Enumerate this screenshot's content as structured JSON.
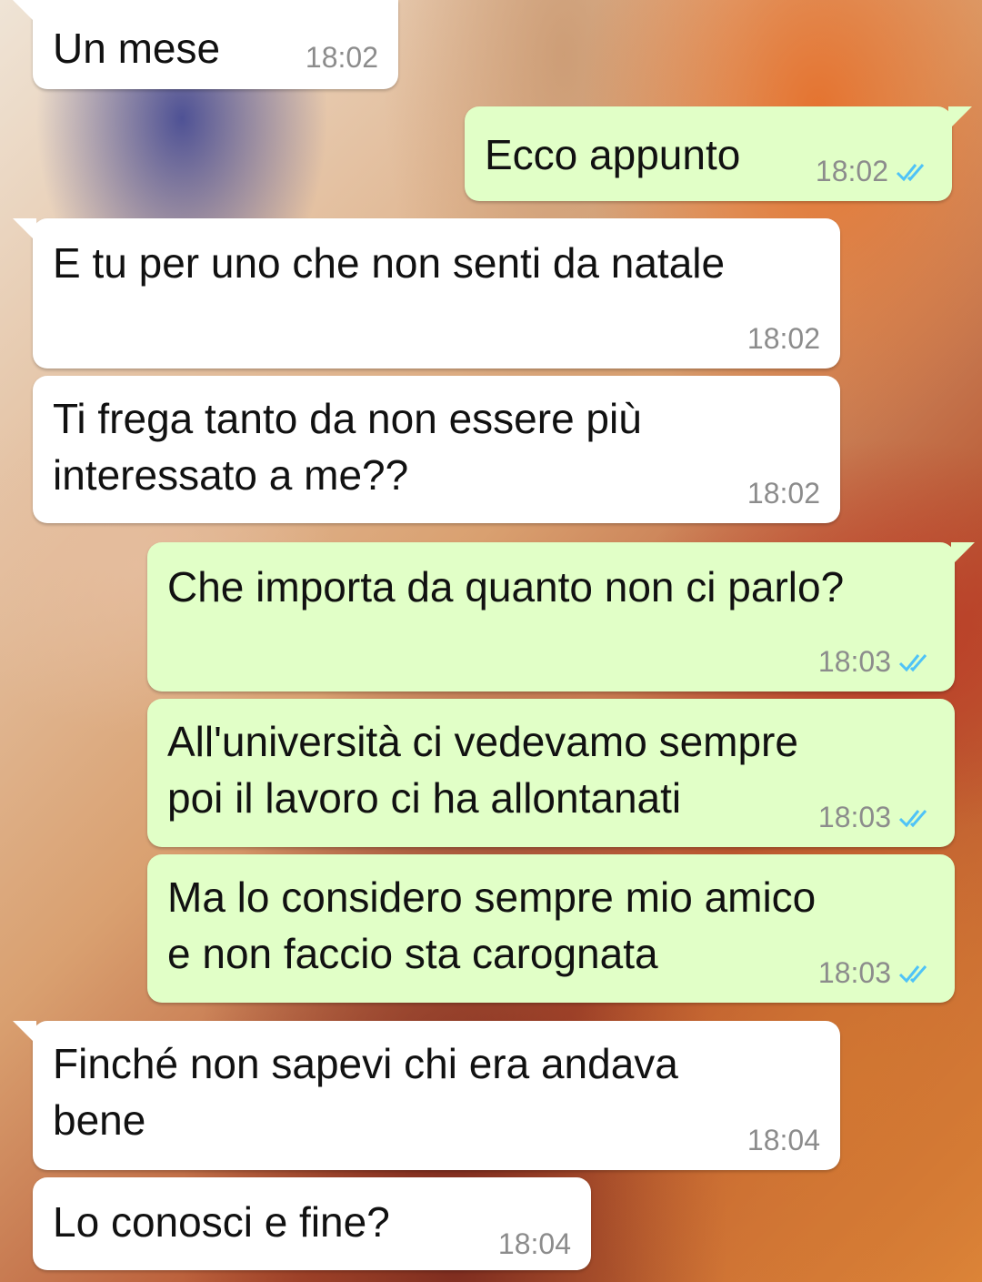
{
  "colors": {
    "incoming_bubble": "#ffffff",
    "outgoing_bubble": "#e1ffc7",
    "read_tick": "#4fc3f7",
    "timestamp": "#8c8c8c"
  },
  "messages": [
    {
      "direction": "incoming",
      "text": "Un mese",
      "time": "18:02"
    },
    {
      "direction": "outgoing",
      "text": "Ecco appunto",
      "time": "18:02",
      "status": "read"
    },
    {
      "direction": "incoming",
      "text": "E tu per uno che non senti da natale",
      "time": "18:02"
    },
    {
      "direction": "incoming",
      "text": "Ti frega tanto da non essere più\ninteressato a me??",
      "time": "18:02"
    },
    {
      "direction": "outgoing",
      "text": "Che importa da quanto non ci parlo?",
      "time": "18:03",
      "status": "read"
    },
    {
      "direction": "outgoing",
      "text": "All'università ci vedevamo sempre\npoi il lavoro ci ha allontanati",
      "time": "18:03",
      "status": "read"
    },
    {
      "direction": "outgoing",
      "text": "Ma lo considero sempre mio amico\ne non faccio sta carognata",
      "time": "18:03",
      "status": "read"
    },
    {
      "direction": "incoming",
      "text": "Finché non sapevi chi era andava\nbene",
      "time": "18:04"
    },
    {
      "direction": "incoming",
      "text": "Lo conosci e fine?",
      "time": "18:04"
    }
  ]
}
